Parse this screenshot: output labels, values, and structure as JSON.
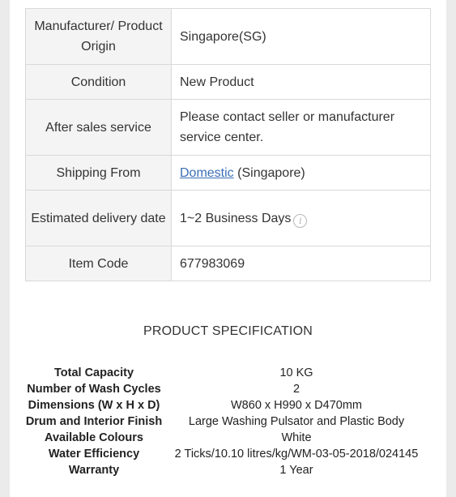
{
  "info_rows": [
    {
      "label": "Manufacturer/ Product Origin",
      "value": "Singapore(SG)"
    },
    {
      "label": "Condition",
      "value": "New Product"
    },
    {
      "label": "After sales service",
      "value": "Please contact seller or manufacturer service center."
    },
    {
      "label": "Shipping From",
      "link": "Domestic",
      "value": "(Singapore)"
    },
    {
      "label": "Estimated delivery date",
      "value": "1~2 Business Days",
      "icon": "info-icon"
    },
    {
      "label": "Item Code",
      "value": "677983069"
    }
  ],
  "spec": {
    "heading": "PRODUCT SPECIFICATION",
    "rows": [
      {
        "label": "Total Capacity",
        "value": "10 KG"
      },
      {
        "label": "Number of Wash Cycles",
        "value": "2"
      },
      {
        "label": "Dimensions (W x H x D)",
        "value": "W860 x H990 x D470mm"
      },
      {
        "label": "Drum and Interior Finish",
        "value": "Large Washing Pulsator and Plastic Body"
      },
      {
        "label": "Available Colours",
        "value": "White"
      },
      {
        "label": "Water Efficiency",
        "value": "2 Ticks/10.10 litres/kg/WM-03-05-2018/024145"
      },
      {
        "label": "Warranty",
        "value": "1 Year"
      }
    ]
  },
  "colors": {
    "link": "#3b6fb6",
    "label_background": "#f4f4f4",
    "border": "#d9d9d9"
  }
}
